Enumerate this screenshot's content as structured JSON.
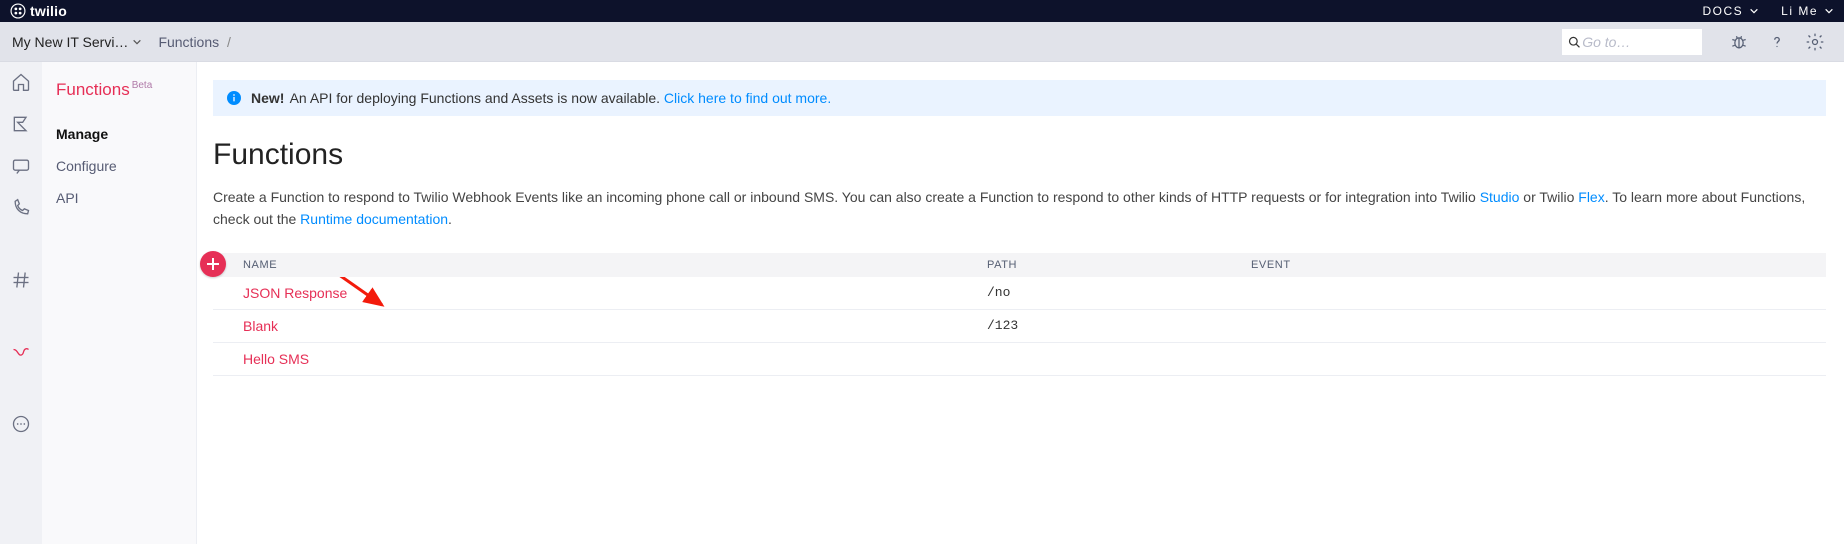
{
  "topnav": {
    "brand": "twilio",
    "docs_label": "DOCS",
    "user_label": "Li Me"
  },
  "subhead": {
    "project_name": "My New IT Servi…",
    "crumb1": "Functions",
    "search_placeholder": "Go to…"
  },
  "sidebar": {
    "title": "Functions",
    "badge": "Beta",
    "items": [
      "Manage",
      "Configure",
      "API"
    ]
  },
  "banner": {
    "new_label": "New!",
    "text": "An API for deploying Functions and Assets is now available.",
    "link_label": "Click here to find out more."
  },
  "page": {
    "title": "Functions",
    "paragraph_a": "Create a Function to respond to Twilio Webhook Events like an incoming phone call or inbound SMS. You can also create a Function to respond to other kinds of HTTP requests or for integration into Twilio ",
    "studio_link": "Studio",
    "paragraph_b": " or Twilio ",
    "flex_link": "Flex",
    "paragraph_c": ". To learn more about Functions, check out the ",
    "docs_link": "Runtime documentation",
    "paragraph_d": "."
  },
  "table": {
    "headers": {
      "name": "NAME",
      "path": "PATH",
      "event": "EVENT"
    },
    "rows": [
      {
        "name": "JSON Response",
        "path": "/no",
        "event": ""
      },
      {
        "name": "Blank",
        "path": "/123",
        "event": ""
      },
      {
        "name": "Hello SMS",
        "path": "",
        "event": ""
      }
    ]
  }
}
